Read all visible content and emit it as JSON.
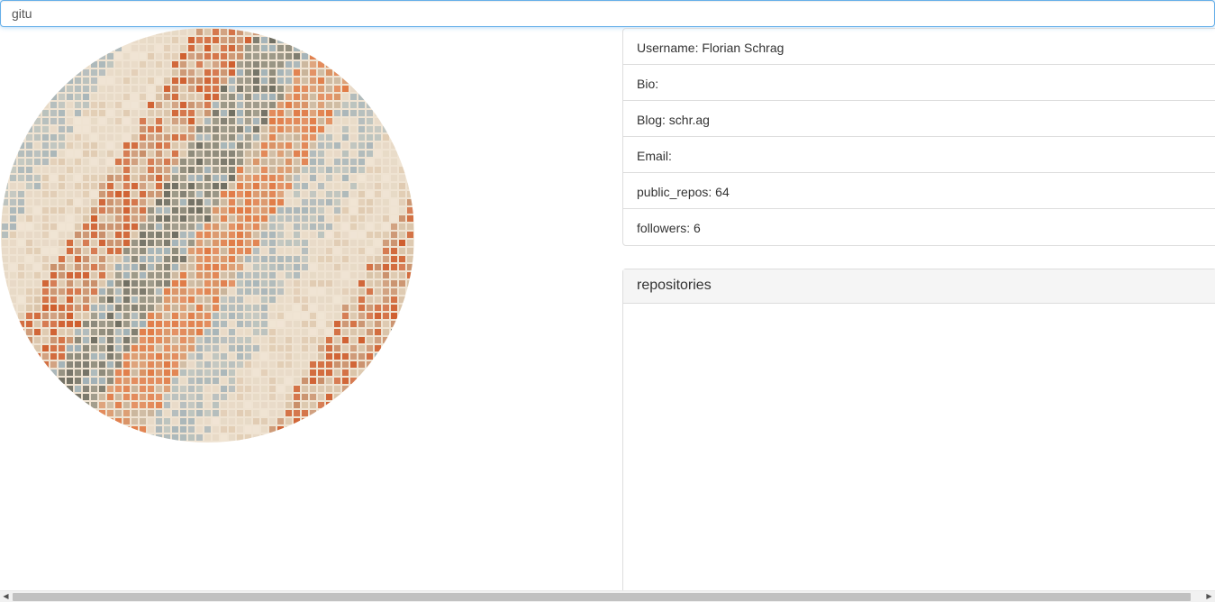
{
  "search": {
    "value": "gitu"
  },
  "user": {
    "username": "Username: Florian Schrag",
    "bio": "Bio:",
    "blog": "Blog: schr.ag",
    "email": "Email:",
    "public_repos": "public_repos: 64",
    "followers": "followers: 6"
  },
  "repositories": {
    "heading": "repositories"
  },
  "scrollbar": {
    "left_arrow": "◀",
    "right_arrow": "▶"
  },
  "colors": {
    "focus_border": "#66afe9",
    "panel_border": "#dddddd",
    "panel_heading_bg": "#f5f5f5"
  }
}
